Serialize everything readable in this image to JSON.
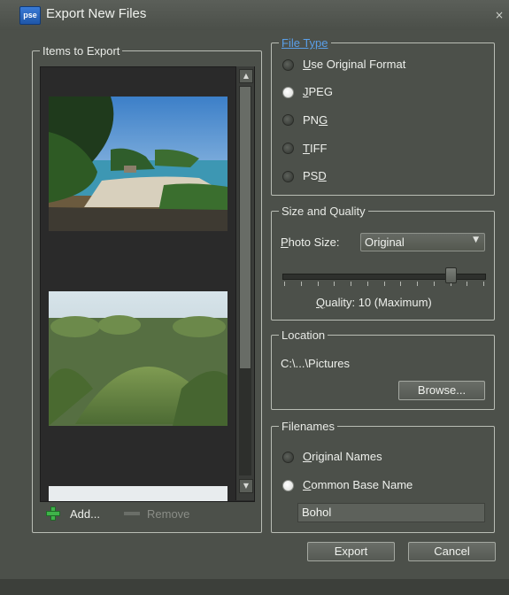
{
  "window": {
    "app_icon_text": "pse",
    "title": "Export New Files",
    "close_glyph": "×"
  },
  "items_to_export": {
    "legend": "Items to Export",
    "thumbnails": [
      "beach-photo",
      "chocolate-hills-photo",
      "partial-photo"
    ],
    "add_label": "Add...",
    "remove_label": "Remove"
  },
  "file_type": {
    "legend": "File Type",
    "options": [
      {
        "label": "Use Original Format",
        "selected": false
      },
      {
        "label": "JPEG",
        "selected": true
      },
      {
        "label": "PNG",
        "selected": false
      },
      {
        "label": "TIFF",
        "selected": false
      },
      {
        "label": "PSD",
        "selected": false
      }
    ]
  },
  "size_quality": {
    "legend": "Size and Quality",
    "photo_size_label": "Photo Size:",
    "photo_size_value": "Original",
    "quality_label": "Quality: 10 (Maximum)",
    "quality_level": 10,
    "quality_max": 12
  },
  "location": {
    "legend": "Location",
    "path": "C:\\...\\Pictures",
    "browse_label": "Browse..."
  },
  "filenames": {
    "legend": "Filenames",
    "options": [
      {
        "label": "Original Names",
        "selected": false
      },
      {
        "label": "Common Base Name",
        "selected": true
      }
    ],
    "base_name_value": "Bohol"
  },
  "actions": {
    "export_label": "Export",
    "cancel_label": "Cancel"
  },
  "colors": {
    "dialog_bg": "#4c504a",
    "link_blue": "#5a9fe8",
    "plus_green": "#3fb34a"
  }
}
